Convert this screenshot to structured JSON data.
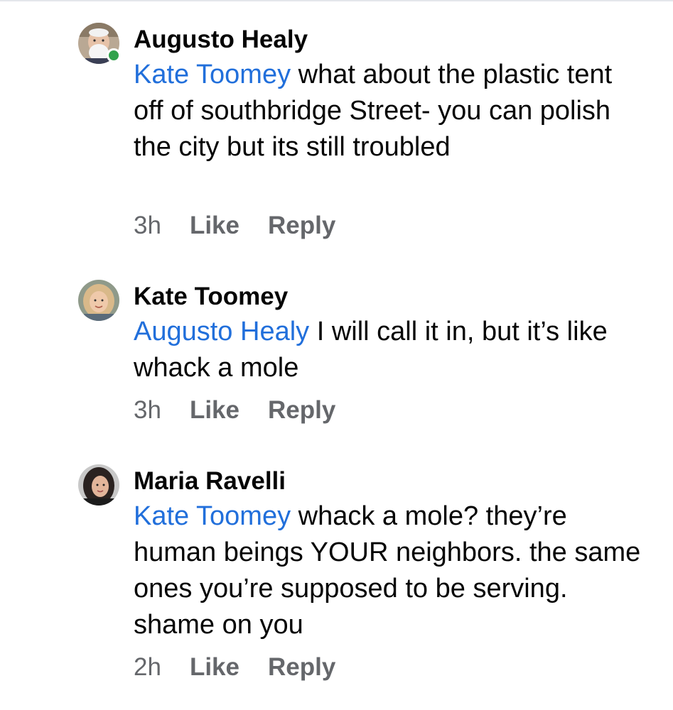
{
  "comments": [
    {
      "author": "Augusto Healy",
      "mention": "Kate Toomey",
      "text": " what about the plastic tent off of southbridge Street- you can polish the city but its still troubled",
      "time": "3h",
      "like_label": "Like",
      "reply_label": "Reply",
      "online": true
    },
    {
      "author": "Kate Toomey",
      "mention": "Augusto Healy",
      "text": " I will call it in, but it’s like whack a mole",
      "time": "3h",
      "like_label": "Like",
      "reply_label": "Reply",
      "online": false
    },
    {
      "author": "Maria Ravelli",
      "mention": "Kate Toomey",
      "text": " whack a mole? they’re human beings YOUR neighbors. the same ones you’re supposed to be serving. shame on you",
      "time": "2h",
      "like_label": "Like",
      "reply_label": "Reply",
      "online": false
    }
  ],
  "colors": {
    "mention": "#216fdb",
    "meta": "#65676b",
    "online": "#31a24c"
  }
}
